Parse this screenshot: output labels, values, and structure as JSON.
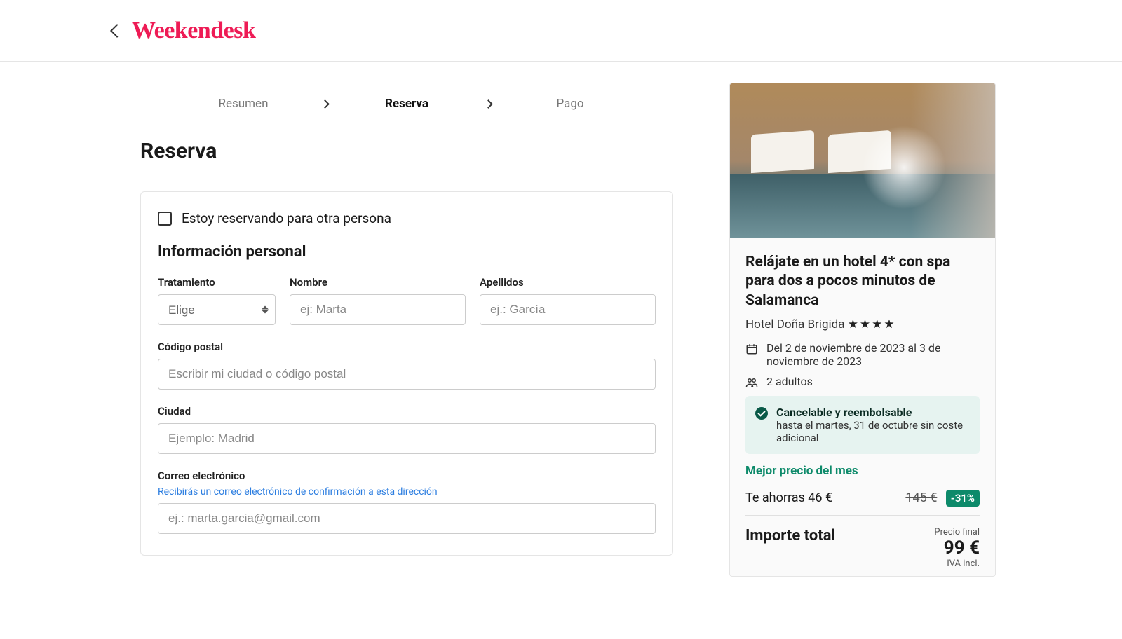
{
  "brand": "Weekendesk",
  "steps": {
    "s1": "Resumen",
    "s2": "Reserva",
    "s3": "Pago"
  },
  "page_title": "Reserva",
  "form": {
    "other_person": "Estoy reservando para otra persona",
    "section": "Información personal",
    "treatment_lbl": "Tratamiento",
    "treatment_ph": "Elige",
    "name_lbl": "Nombre",
    "name_ph": "ej: Marta",
    "surname_lbl": "Apellidos",
    "surname_ph": "ej.: García",
    "postal_lbl": "Código postal",
    "postal_ph": "Escribir mi ciudad o código postal",
    "city_lbl": "Ciudad",
    "city_ph": "Ejemplo: Madrid",
    "email_lbl": "Correo electrónico",
    "email_hint": "Recibirás un correo electrónico de confirmación a esta dirección",
    "email_ph": "ej.: marta.garcia@gmail.com"
  },
  "summary": {
    "title": "Relájate en un hotel 4* con spa para dos a pocos minutos de Salamanca",
    "hotel": "Hotel Doña Brigida",
    "stars": "★★★★",
    "dates": "Del 2 de noviembre de 2023 al 3 de noviembre de 2023",
    "guests": "2 adultos",
    "cancel_title": "Cancelable y reembolsable",
    "cancel_sub": "hasta el martes, 31 de octubre sin coste adicional",
    "best_price": "Mejor precio del mes",
    "savings": "Te ahorras 46 €",
    "old_price": "145 €",
    "discount": "-31%",
    "total_lbl": "Importe total",
    "final_lbl": "Precio final",
    "total": "99 €",
    "vat": "IVA incl."
  }
}
